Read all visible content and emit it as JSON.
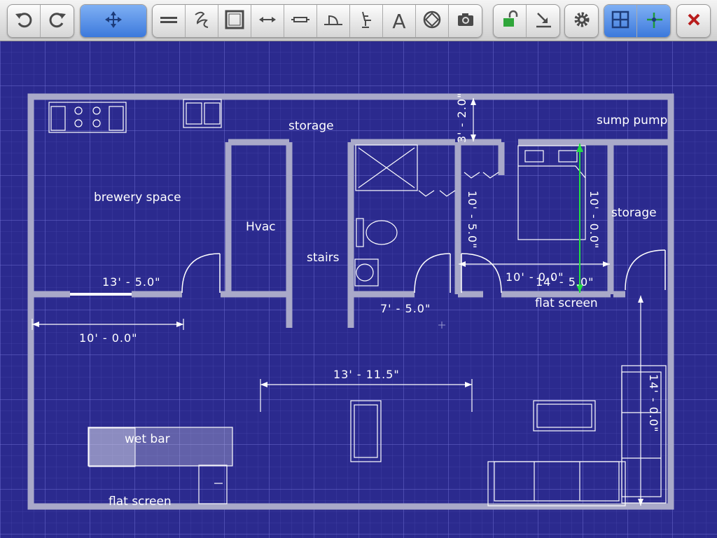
{
  "toolbar": {
    "groups": [
      {
        "name": "history",
        "buttons": [
          {
            "icon": "undo-icon"
          },
          {
            "icon": "redo-icon"
          }
        ]
      },
      {
        "name": "select",
        "buttons": [
          {
            "icon": "move-arrows-icon",
            "active": true
          }
        ]
      },
      {
        "name": "draw",
        "buttons": [
          {
            "icon": "wall-tool-icon"
          },
          {
            "icon": "freehand-tool-icon"
          },
          {
            "icon": "room-tool-icon"
          },
          {
            "icon": "dimension-tool-icon"
          },
          {
            "icon": "window-tool-icon"
          },
          {
            "icon": "door-tool-icon"
          },
          {
            "icon": "furniture-tool-icon"
          },
          {
            "icon": "text-tool-icon",
            "text": "A"
          },
          {
            "icon": "symbol-tool-icon"
          },
          {
            "icon": "camera-icon"
          }
        ]
      },
      {
        "name": "layers",
        "buttons": [
          {
            "icon": "unlock-icon"
          },
          {
            "icon": "export-icon"
          }
        ]
      },
      {
        "name": "settings",
        "buttons": [
          {
            "icon": "gear-icon"
          }
        ]
      },
      {
        "name": "grid",
        "buttons": [
          {
            "icon": "grid-icon",
            "active": true
          },
          {
            "icon": "snap-icon",
            "active": true
          }
        ]
      },
      {
        "name": "close",
        "buttons": [
          {
            "icon": "close-icon"
          }
        ]
      }
    ]
  },
  "plan": {
    "rooms": {
      "brewery": "brewery space",
      "hvac": "Hvac",
      "storage_top": "storage",
      "stairs": "stairs",
      "sump": "sump pump",
      "storage_right": "storage",
      "flat_screen_right": "flat screen",
      "wet_bar": "wet bar",
      "flat_screen_bottom": "flat screen"
    },
    "dimensions": {
      "d_13_5": "13' - 5.0\"",
      "d_10_0_left": "10' - 0.0\"",
      "d_7_5": "7' - 5.0\"",
      "d_13_115": "13' - 11.5\"",
      "d_10_0_mid": "10' - 0.0\"",
      "d_14_5": "14' - 5.0\"",
      "d_3_2": "3' - 2.0\"",
      "d_10_5_vert": "10' - 5.0\"",
      "d_10_0_vert": "10' - 0.0\"",
      "d_14_0_vert": "14' - 0.0\""
    },
    "colors": {
      "background": "#2b2a8e",
      "wall": "#a9a9c9",
      "line": "#ffffff",
      "guide": "#22dd44"
    }
  }
}
